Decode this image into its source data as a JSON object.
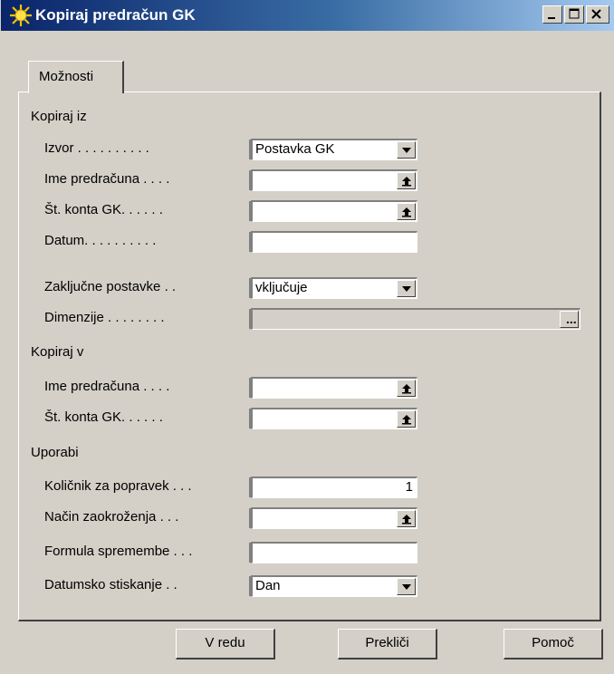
{
  "window": {
    "title": "Kopiraj predračun GK"
  },
  "tabs": [
    {
      "label": "Možnosti"
    }
  ],
  "sections": {
    "copy_from": {
      "heading": "Kopiraj iz",
      "fields": [
        {
          "label": "Izvor . . . . . . . . . .",
          "value": "Postavka GK",
          "control": "dropdown"
        },
        {
          "label": "Ime predračuna . . . .",
          "value": "",
          "control": "lookup"
        },
        {
          "label": "Št. konta GK. . . . . .",
          "value": "",
          "control": "lookup"
        },
        {
          "label": "Datum. . . . . . . . . .",
          "value": "",
          "control": "text"
        },
        {
          "label": "Zaključne postavke . .",
          "value": "vključuje",
          "control": "dropdown"
        },
        {
          "label": "Dimenzije . . . . . . . .",
          "value": "",
          "control": "assist",
          "assist_label": "..."
        }
      ]
    },
    "copy_to": {
      "heading": "Kopiraj v",
      "fields": [
        {
          "label": "Ime predračuna . . . .",
          "value": "",
          "control": "lookup"
        },
        {
          "label": "Št. konta GK. . . . . .",
          "value": "",
          "control": "lookup"
        }
      ]
    },
    "apply": {
      "heading": "Uporabi",
      "fields": [
        {
          "label": "Količnik za popravek . . .",
          "value": "1",
          "control": "number"
        },
        {
          "label": "Način zaokroženja . . .",
          "value": "",
          "control": "lookup"
        },
        {
          "label": "Formula spremembe . . .",
          "value": "",
          "control": "text"
        },
        {
          "label": "Datumsko stiskanje . .",
          "value": "Dan",
          "control": "dropdown"
        }
      ]
    }
  },
  "buttons": {
    "ok": "V redu",
    "cancel": "Prekliči",
    "help": "Pomoč"
  },
  "colors": {
    "face": "#d4d0c8",
    "title_start": "#0a246a",
    "title_end": "#a6caf0"
  }
}
